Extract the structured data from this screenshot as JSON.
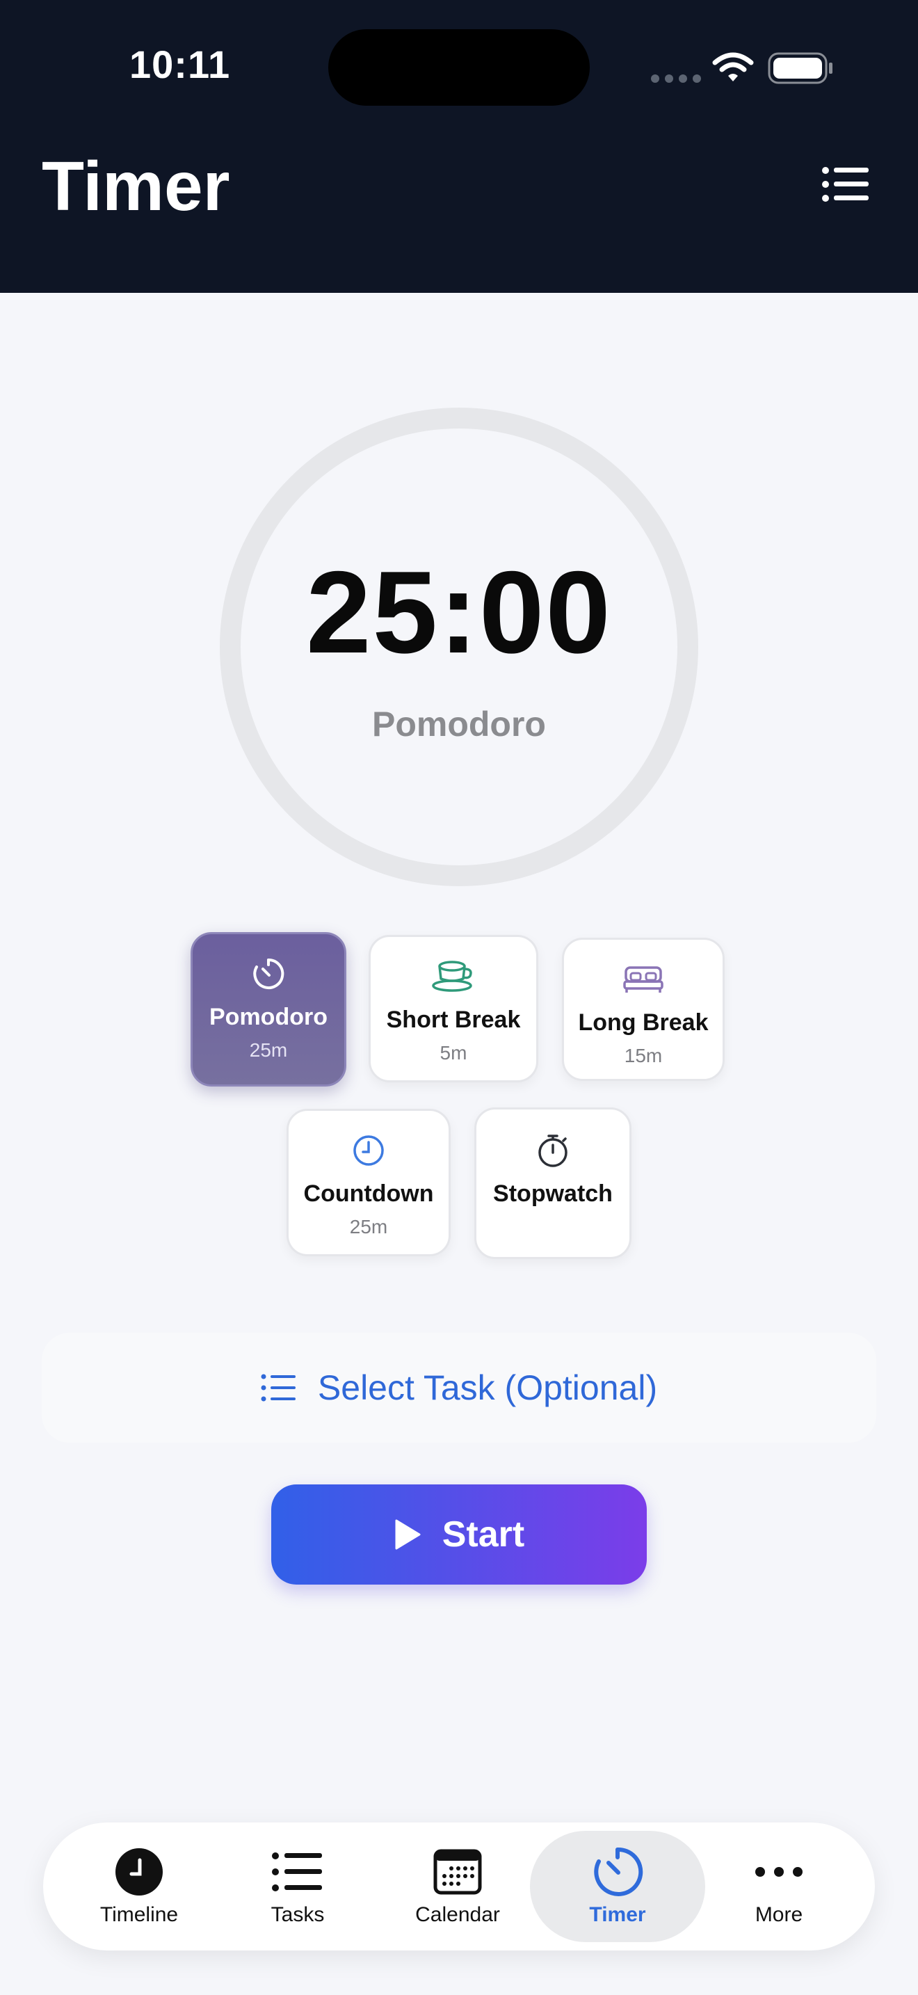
{
  "status_bar": {
    "time": "10:11"
  },
  "header": {
    "title": "Timer"
  },
  "timer": {
    "time": "25:00",
    "mode": "Pomodoro"
  },
  "modes": [
    {
      "name": "Pomodoro",
      "duration": "25m",
      "icon": "timer-icon",
      "active": true
    },
    {
      "name": "Short Break",
      "duration": "5m",
      "icon": "cup-icon",
      "active": false
    },
    {
      "name": "Long Break",
      "duration": "15m",
      "icon": "bed-icon",
      "active": false
    },
    {
      "name": "Countdown",
      "duration": "25m",
      "icon": "clock-icon",
      "active": false
    },
    {
      "name": "Stopwatch",
      "duration": "",
      "icon": "stopwatch-icon",
      "active": false
    }
  ],
  "task_selector": {
    "label": "Select Task (Optional)",
    "icon": "list-icon"
  },
  "start_button": {
    "label": "Start",
    "icon": "play-icon"
  },
  "tab_bar": {
    "tabs": [
      {
        "label": "Timeline",
        "icon": "clock-icon",
        "active": false
      },
      {
        "label": "Tasks",
        "icon": "list-icon",
        "active": false
      },
      {
        "label": "Calendar",
        "icon": "calendar-icon",
        "active": false
      },
      {
        "label": "Timer",
        "icon": "timer-icon",
        "active": true
      },
      {
        "label": "More",
        "icon": "ellipsis-icon",
        "active": false
      }
    ]
  },
  "colors": {
    "header_bg": "#0e1525",
    "accent_blue": "#2f68d8",
    "active_mode": "#6b5f9e",
    "start_gradient_start": "#3160e8",
    "start_gradient_end": "#7b3de9",
    "short_break_icon": "#2f9a7a",
    "long_break_icon": "#8a74b5",
    "countdown_icon": "#3d7ae0"
  }
}
